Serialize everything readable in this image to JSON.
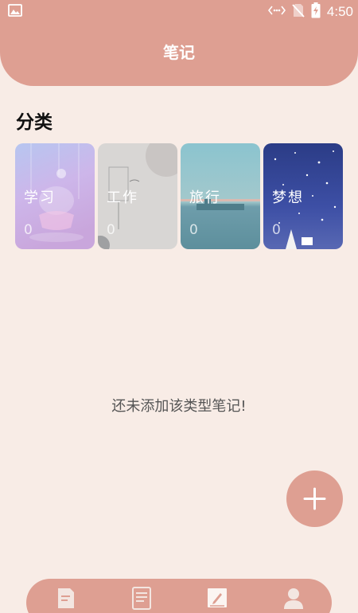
{
  "status_bar": {
    "time": "4:50",
    "icons": [
      "image-icon",
      "wifi-calling-icon",
      "no-sim-icon",
      "battery-charging-icon"
    ]
  },
  "header": {
    "title": "笔记"
  },
  "section": {
    "title": "分类"
  },
  "categories": [
    {
      "label": "学习",
      "count": "0"
    },
    {
      "label": "工作",
      "count": "0"
    },
    {
      "label": "旅行",
      "count": "0"
    },
    {
      "label": "梦想",
      "count": "0"
    }
  ],
  "empty_message": "还未添加该类型笔记!",
  "fab": {
    "icon": "plus-icon"
  },
  "bottom_nav": {
    "items": [
      {
        "icon": "note-icon"
      },
      {
        "icon": "clipboard-list-icon"
      },
      {
        "icon": "edit-note-icon"
      },
      {
        "icon": "user-icon"
      }
    ]
  },
  "colors": {
    "primary": "#de9f92",
    "background": "#f8ece6",
    "text_dark": "#111111"
  }
}
